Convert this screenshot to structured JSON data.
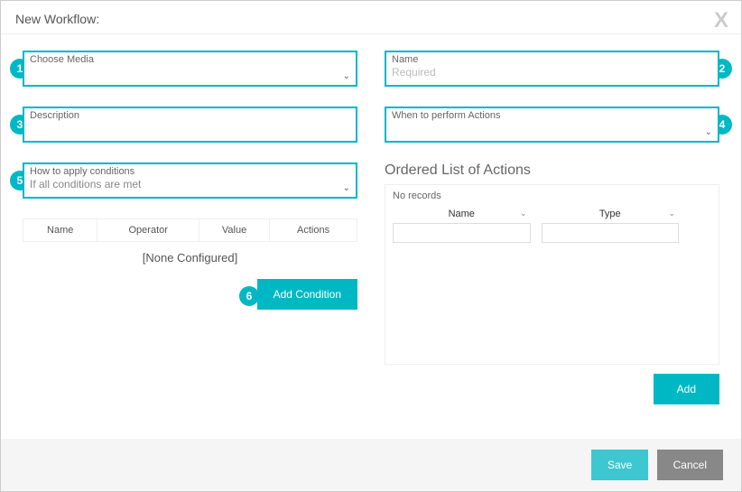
{
  "header": {
    "title": "New Workflow:"
  },
  "badges": {
    "b1": "1",
    "b2": "2",
    "b3": "3",
    "b4": "4",
    "b5": "5",
    "b6": "6"
  },
  "left": {
    "choose_media": {
      "label": "Choose Media",
      "value": ""
    },
    "description": {
      "label": "Description",
      "value": ""
    },
    "how_apply": {
      "label": "How to apply conditions",
      "value": "If all conditions are met"
    },
    "cond_headers": {
      "name": "Name",
      "operator": "Operator",
      "value": "Value",
      "actions": "Actions"
    },
    "none_configured": "[None Configured]",
    "add_condition": "Add Condition"
  },
  "right": {
    "name": {
      "label": "Name",
      "placeholder": "Required",
      "value": ""
    },
    "when": {
      "label": "When to perform Actions",
      "value": ""
    },
    "ordered_title": "Ordered List of Actions",
    "no_records": "No records",
    "action_cols": {
      "name": "Name",
      "type": "Type"
    },
    "add": "Add"
  },
  "footer": {
    "save": "Save",
    "cancel": "Cancel"
  }
}
